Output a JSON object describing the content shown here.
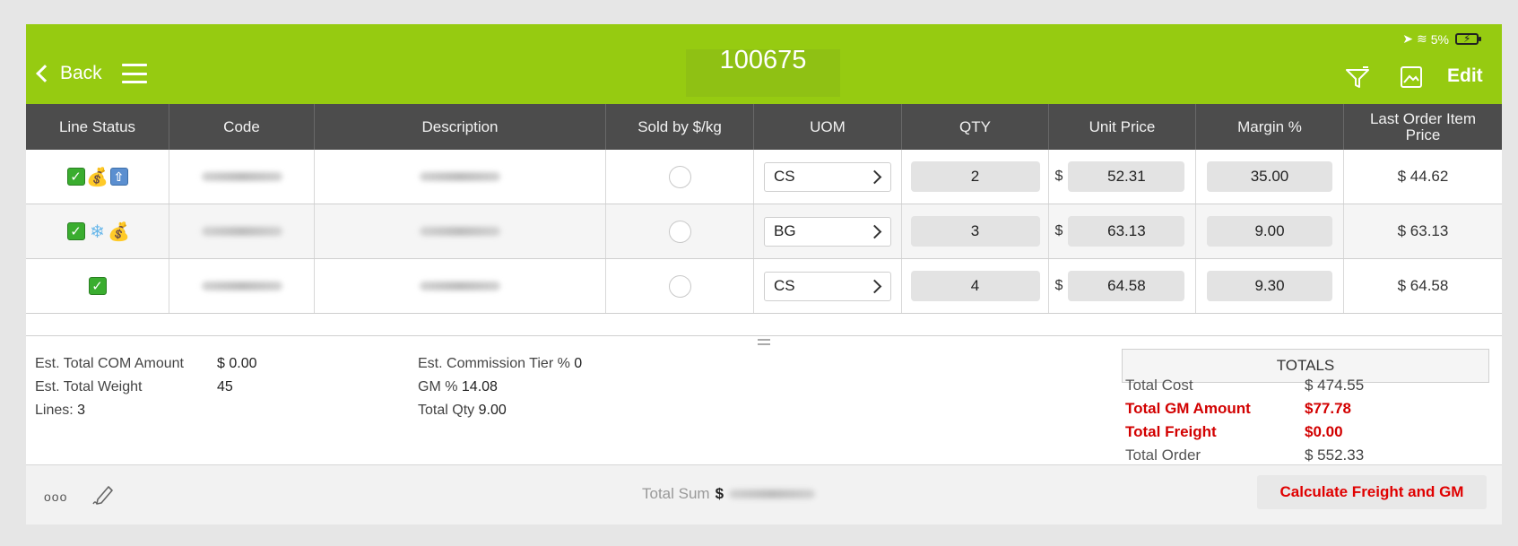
{
  "status_bar": {
    "battery": "5%"
  },
  "nav": {
    "back_label": "Back",
    "title": "100675",
    "edit_label": "Edit",
    "color": "#96cb11"
  },
  "table": {
    "columns": [
      "Line Status",
      "Code",
      "Description",
      "Sold by $/kg",
      "UOM",
      "QTY",
      "Unit Price",
      "Margin %",
      "Last Order Item Price"
    ],
    "rows": [
      {
        "status_icons": [
          "check-icon",
          "money-bag-icon",
          "arrow-up-icon"
        ],
        "uom": "CS",
        "qty": "2",
        "currency": "$",
        "unit_price": "52.31",
        "margin": "35.00",
        "last_price": "$ 44.62"
      },
      {
        "status_icons": [
          "check-icon",
          "snowflake-icon",
          "money-bag-icon"
        ],
        "uom": "BG",
        "qty": "3",
        "currency": "$",
        "unit_price": "63.13",
        "margin": "9.00",
        "last_price": "$ 63.13"
      },
      {
        "status_icons": [
          "check-icon"
        ],
        "uom": "CS",
        "qty": "4",
        "currency": "$",
        "unit_price": "64.58",
        "margin": "9.30",
        "last_price": "$ 64.58"
      }
    ]
  },
  "summary": {
    "com_label": "Est. Total COM Amount",
    "com_value": "$ 0.00",
    "weight_label": "Est. Total Weight",
    "weight_value": "45",
    "lines_label": "Lines:",
    "lines_value": "3",
    "tier_label": "Est. Commission Tier %",
    "tier_value": "0",
    "gm_label": "GM %",
    "gm_value": "14.08",
    "qty_label": "Total Qty",
    "qty_value": "9.00"
  },
  "totals": {
    "heading": "TOTALS",
    "cost_label": "Total Cost",
    "cost_value": "$ 474.55",
    "gm_amount_label": "Total GM Amount",
    "gm_amount_value": "$77.78",
    "freight_label": "Total Freight",
    "freight_value": "$0.00",
    "order_label": "Total Order",
    "order_value": "$ 552.33",
    "highlight_color": "#d20000"
  },
  "toolbar": {
    "more_label": "ooo",
    "total_sum_label": "Total Sum",
    "total_sum_currency": "$",
    "calc_label": "Calculate Freight and GM"
  }
}
